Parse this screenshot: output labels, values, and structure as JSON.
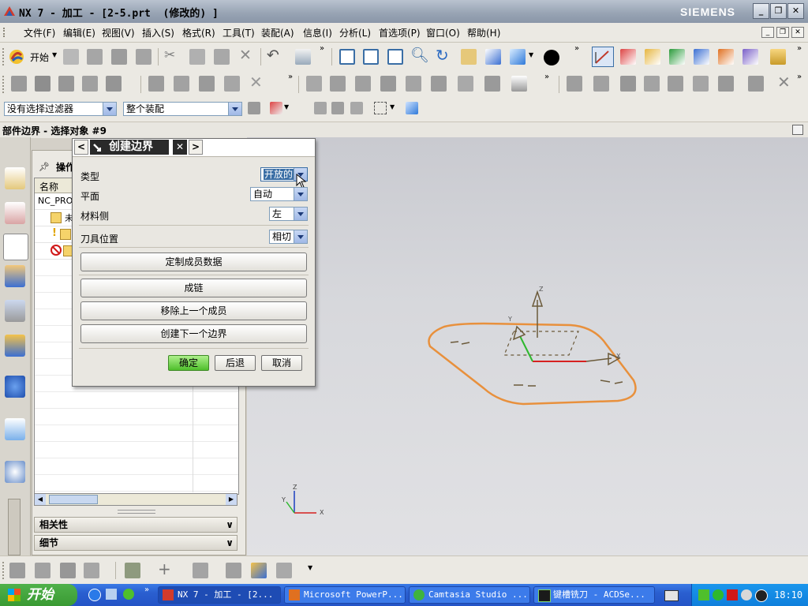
{
  "window": {
    "title": "NX 7 - 加工 - [2-5.prt  (修改的) ]",
    "brand": "SIEMENS"
  },
  "menu": {
    "items": [
      "文件(F)",
      "编辑(E)",
      "视图(V)",
      "插入(S)",
      "格式(R)",
      "工具(T)",
      "装配(A)",
      "信息(I)",
      "分析(L)",
      "首选项(P)",
      "窗口(O)",
      "帮助(H)"
    ]
  },
  "toolbar": {
    "start_label": "开始"
  },
  "selection": {
    "filter_value": "没有选择过滤器",
    "scope_value": "整个装配"
  },
  "status": {
    "prompt": "部件边界 - 选择对象 #9"
  },
  "navigator": {
    "title": "操作",
    "column_name": "名称",
    "root": "NC_PRO",
    "child1": "未",
    "collapsibles": [
      "相关性",
      "细节"
    ]
  },
  "dialog": {
    "title": "创建边界",
    "fields": [
      {
        "label": "类型",
        "value": "开放的"
      },
      {
        "label": "平面",
        "value": "自动"
      },
      {
        "label": "材料侧",
        "value": "左"
      },
      {
        "label": "刀具位置",
        "value": "相切"
      }
    ],
    "buttons": {
      "custom_member": "定制成员数据",
      "chain": "成链",
      "remove_last": "移除上一个成员",
      "create_next": "创建下一个边界"
    },
    "ok": "确定",
    "back": "后退",
    "cancel": "取消"
  },
  "graphics": {
    "axis_z": "Z",
    "axis_x": "X",
    "axis_y": "Y",
    "triad_z": "Z",
    "triad_x": "X",
    "triad_y": "Y"
  },
  "taskbar": {
    "start": "开始",
    "tasks": [
      {
        "label": "NX 7 - 加工 - [2..."
      },
      {
        "label": "Microsoft PowerP..."
      },
      {
        "label": "Camtasia Studio ..."
      },
      {
        "label": "键槽铣刀 - ACDSe..."
      }
    ],
    "time": "18:10"
  },
  "colors": {
    "boundary": "#e8903c",
    "accent": "#3a6ea5",
    "ok_button": "#6fd44a",
    "siemens": "#ffffff"
  }
}
